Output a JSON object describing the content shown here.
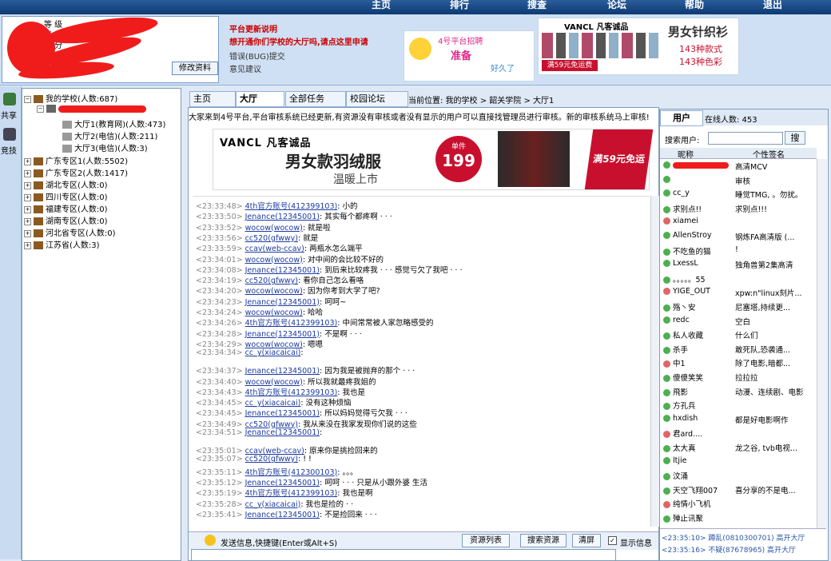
{
  "topnav": [
    "主页",
    "排行",
    "搜查",
    "论坛",
    "帮助",
    "退出"
  ],
  "user_profile": {
    "labels": [
      "等 级",
      "帐 号",
      "积 分",
      "昵 称"
    ],
    "edit_button": "修改资料"
  },
  "notices": [
    "平台更新说明",
    "想开通你们学校的大厅吗,请点这里申请",
    "错误(BUG)提交",
    "意见建议"
  ],
  "ad_small": {
    "line1": "4号平台招聘",
    "line2": "准备",
    "line3": "好久了"
  },
  "ad_vancl_knit": {
    "brand": "VANCL 凡客诚品",
    "title": "男女针织衫",
    "sub1": "143种款式",
    "sub2": "143种色彩",
    "badge": "满59元免运费"
  },
  "sidebar": {
    "share": "共享",
    "download": "竞技"
  },
  "tree": {
    "root": "我的学校(人数:687)",
    "halls": [
      "大厅1(教育网)(人数:473)",
      "大厅2(电信)(人数:211)",
      "大厅3(电信)(人数:3)"
    ],
    "regions": [
      "广东专区1(人数:5502)",
      "广东专区2(人数:1417)",
      "湖北专区(人数:0)",
      "四川专区(人数:0)",
      "福建专区(人数:0)",
      "湖南专区(人数:0)",
      "河北省专区(人数:0)",
      "江苏省(人数:3)"
    ]
  },
  "tabs": [
    "主页",
    "大厅",
    "全部任务",
    "校园论坛"
  ],
  "location": "当前位置: 我的学校 > 韶关学院 > 大厅1",
  "marquee": "大家来到4号平台,平台审核系统已经更新,有资源没有审核或者没有显示的用户可以直接找管理员进行审核。新的审核系统马上审核!",
  "banner": {
    "brand": "VANCL 凡客诚品",
    "headline": "男女款羽绒服",
    "sub": "温暖上市",
    "price_label": "单件",
    "price": "199",
    "badge": "满59元免运费"
  },
  "chat": [
    {
      "t": "<23:33:48>",
      "n": "4th官方账号(412399103)",
      "m": ": 小的"
    },
    {
      "t": "<23:33:50>",
      "n": "Jenance(12345001)",
      "m": ": 其实每个都疼啊 · · ·"
    },
    {
      "t": "<23:33:52>",
      "n": "wocow(wocow)",
      "m": ": 就是啦"
    },
    {
      "t": "<23:33:56>",
      "n": "cc520(gfwwy)",
      "m": ": 就是"
    },
    {
      "t": "<23:33:59>",
      "n": "ccav(web-ccav)",
      "m": ": 两瓶水怎么端平"
    },
    {
      "t": "<23:34:01>",
      "n": "wocow(wocow)",
      "m": ": 对中间的会比较不好的"
    },
    {
      "t": "<23:34:08>",
      "n": "Jenance(12345001)",
      "m": ": 到后来比较疼我 · · · 感觉亏欠了我吧 · · ·"
    },
    {
      "t": "<23:34:19>",
      "n": "cc520(gfwwy)",
      "m": ": 看你自己怎么看咯"
    },
    {
      "t": "<23:34:20>",
      "n": "wocow(wocow)",
      "m": ": 因为你考到大学了吧?"
    },
    {
      "t": "<23:34:23>",
      "n": "Jenance(12345001)",
      "m": ": 呵呵~"
    },
    {
      "t": "<23:34:24>",
      "n": "wocow(wocow)",
      "m": ": 哈哈"
    },
    {
      "t": "<23:34:26>",
      "n": "4th官方账号(412399103)",
      "m": ": 中间常常被人家忽略感受的"
    },
    {
      "t": "<23:34:28>",
      "n": "Jenance(12345001)",
      "m": ": 不是啊 · · ·"
    },
    {
      "t": "<23:34:29>",
      "n": "wocow(wocow)",
      "m": ": 嗯嗯"
    },
    {
      "t": "<23:34:34>",
      "n": "cc_y(xiacaicai)",
      "m": ":"
    },
    {
      "t": "<23:34:37>",
      "n": "Jenance(12345001)",
      "m": ": 因为我是被抛弃的那个 · · ·"
    },
    {
      "t": "<23:34:40>",
      "n": "wocow(wocow)",
      "m": ": 所以我就最疼我姐的"
    },
    {
      "t": "<23:34:43>",
      "n": "4th官方账号(412399103)",
      "m": ": 我也是"
    },
    {
      "t": "<23:34:45>",
      "n": "cc_y(xiacaicai)",
      "m": ": 没有这种烦恼"
    },
    {
      "t": "<23:34:45>",
      "n": "Jenance(12345001)",
      "m": ": 所以妈妈觉得亏欠我 · · ·"
    },
    {
      "t": "<23:34:49>",
      "n": "cc520(gfwwy)",
      "m": ": 我从来没在我家发现你们说的这些"
    },
    {
      "t": "<23:34:51>",
      "n": "Jenance(12345001)",
      "m": ":"
    },
    {
      "t": "<23:35:01>",
      "n": "ccav(web-ccav)",
      "m": ": 原来你是挑捡回来的"
    },
    {
      "t": "<23:35:07>",
      "n": "cc520(gfwwy)",
      "m": ": ! !"
    },
    {
      "t": "<23:35:11>",
      "n": "4th官方账号(412300103)",
      "m": ": 。。。"
    },
    {
      "t": "<23:35:12>",
      "n": "Jenance(12345001)",
      "m": ": 呵呵 · · · 只是从小跟外婆 生活"
    },
    {
      "t": "<23:35:19>",
      "n": "4th官方账号(412399103)",
      "m": ": 我也是啊"
    },
    {
      "t": "<23:35:28>",
      "n": "cc_y(xiacaicai)",
      "m": ": 我也是捡的 · ·"
    },
    {
      "t": "<23:35:41>",
      "n": "Jenance(12345001)",
      "m": ": 不是捡回来 · · ·"
    }
  ],
  "bottombar": {
    "hint": "发送信息,快捷键(Enter或Alt+S)",
    "btn1": "资源列表",
    "btn2": "搜索资源",
    "btn3": "清屏",
    "checkbox": "显示信息"
  },
  "userpanel": {
    "tab_users": "用户",
    "tab_online": "在线人数: 453",
    "search_label": "搜索用户:",
    "search_btn": "搜",
    "col1": "昵称",
    "col2": "个性签名",
    "users": [
      {
        "n": "",
        "s": "高清MCV"
      },
      {
        "n": "",
        "s": "审核"
      },
      {
        "n": "cc_y",
        "s": "睡觉TMG, 。勿扰。"
      },
      {
        "n": "求别点!!",
        "s": "求别点!!!"
      },
      {
        "n": "xiamei",
        "s": ""
      },
      {
        "n": "AllenStroy",
        "s": "钢炼FA高清版 (..."
      },
      {
        "n": "不吃鱼的猫",
        "s": "!"
      },
      {
        "n": "LxessL",
        "s": "独角兽第2集高清"
      },
      {
        "n": "。。。。。55",
        "s": ""
      },
      {
        "n": "YIGE_OUT",
        "s": "xpw:n\"linux刻片..."
      },
      {
        "n": "殇丶安",
        "s": "尼塞塔,持续更..."
      },
      {
        "n": "redc",
        "s": "空白"
      },
      {
        "n": "私人收藏",
        "s": "什么们"
      },
      {
        "n": "杀手",
        "s": "敢死队,恐袭通..."
      },
      {
        "n": "中1",
        "s": "除了电影,暗都..."
      },
      {
        "n": "傻傻笑笑",
        "s": "拉拉拉"
      },
      {
        "n": "飛影",
        "s": "动漫、连续剧、电影"
      },
      {
        "n": "方孔兵",
        "s": ""
      },
      {
        "n": "hxdish",
        "s": "都是好电影啊作"
      },
      {
        "n": "君ard....",
        "s": ""
      },
      {
        "n": "太大真",
        "s": "龙之谷, tvb电视..."
      },
      {
        "n": "ltjie",
        "s": ""
      },
      {
        "n": "汶涌",
        "s": ""
      },
      {
        "n": "天空飞翔007",
        "s": "喜分享的不是电..."
      },
      {
        "n": "纯情小飞机",
        "s": ""
      },
      {
        "n": "殚止讯聚",
        "s": ""
      }
    ],
    "log": [
      "<23:35:10> 蹲乱(0810300701)  高开大厅",
      "<23:35:16> 不疑(87678965)  高开大厅"
    ]
  }
}
